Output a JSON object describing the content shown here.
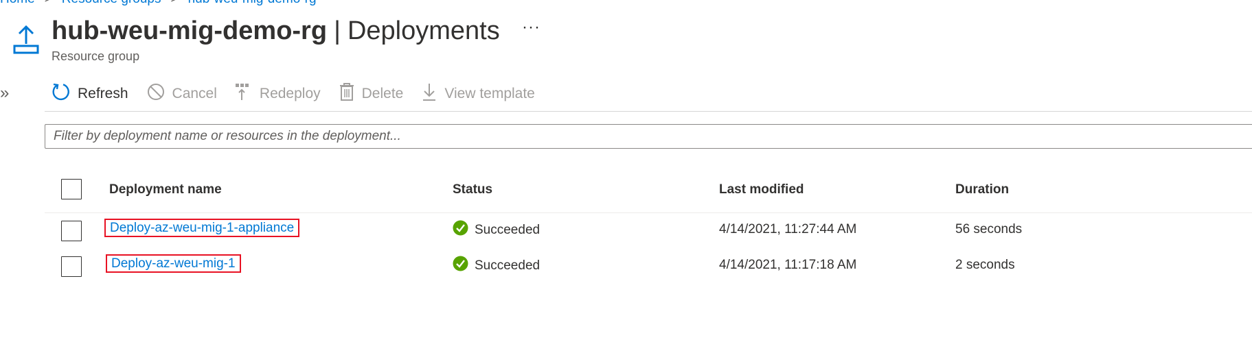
{
  "breadcrumb": [
    "Home",
    "Resource groups",
    "hub-weu-mig-demo-rg"
  ],
  "header": {
    "resource_name": "hub-weu-mig-demo-rg",
    "separator": "|",
    "blade_name": "Deployments",
    "more": "···",
    "subtitle": "Resource group",
    "icon": "deployments-upload-icon"
  },
  "sidebar": {
    "expand": "»"
  },
  "toolbar": {
    "items": [
      {
        "label": "Refresh",
        "icon": "refresh-icon",
        "enabled": true
      },
      {
        "label": "Cancel",
        "icon": "cancel-icon",
        "enabled": false
      },
      {
        "label": "Redeploy",
        "icon": "redeploy-icon",
        "enabled": false
      },
      {
        "label": "Delete",
        "icon": "delete-icon",
        "enabled": false
      },
      {
        "label": "View template",
        "icon": "download-icon",
        "enabled": false
      }
    ]
  },
  "filter": {
    "placeholder": "Filter by deployment name or resources in the deployment...",
    "value": ""
  },
  "table": {
    "columns": [
      "Deployment name",
      "Status",
      "Last modified",
      "Duration"
    ],
    "rows": [
      {
        "name": "Deploy-az-weu-mig-1-appliance",
        "status": "Succeeded",
        "last_modified": "4/14/2021, 11:27:44 AM",
        "duration": "56 seconds",
        "checked": false,
        "highlighted": true
      },
      {
        "name": "Deploy-az-weu-mig-1",
        "status": "Succeeded",
        "last_modified": "4/14/2021, 11:17:18 AM",
        "duration": "2 seconds",
        "checked": false,
        "highlighted": true
      }
    ]
  },
  "colors": {
    "accent": "#0078d4",
    "success": "#57a300",
    "highlight": "#e81123",
    "disabled": "#a19f9d"
  }
}
